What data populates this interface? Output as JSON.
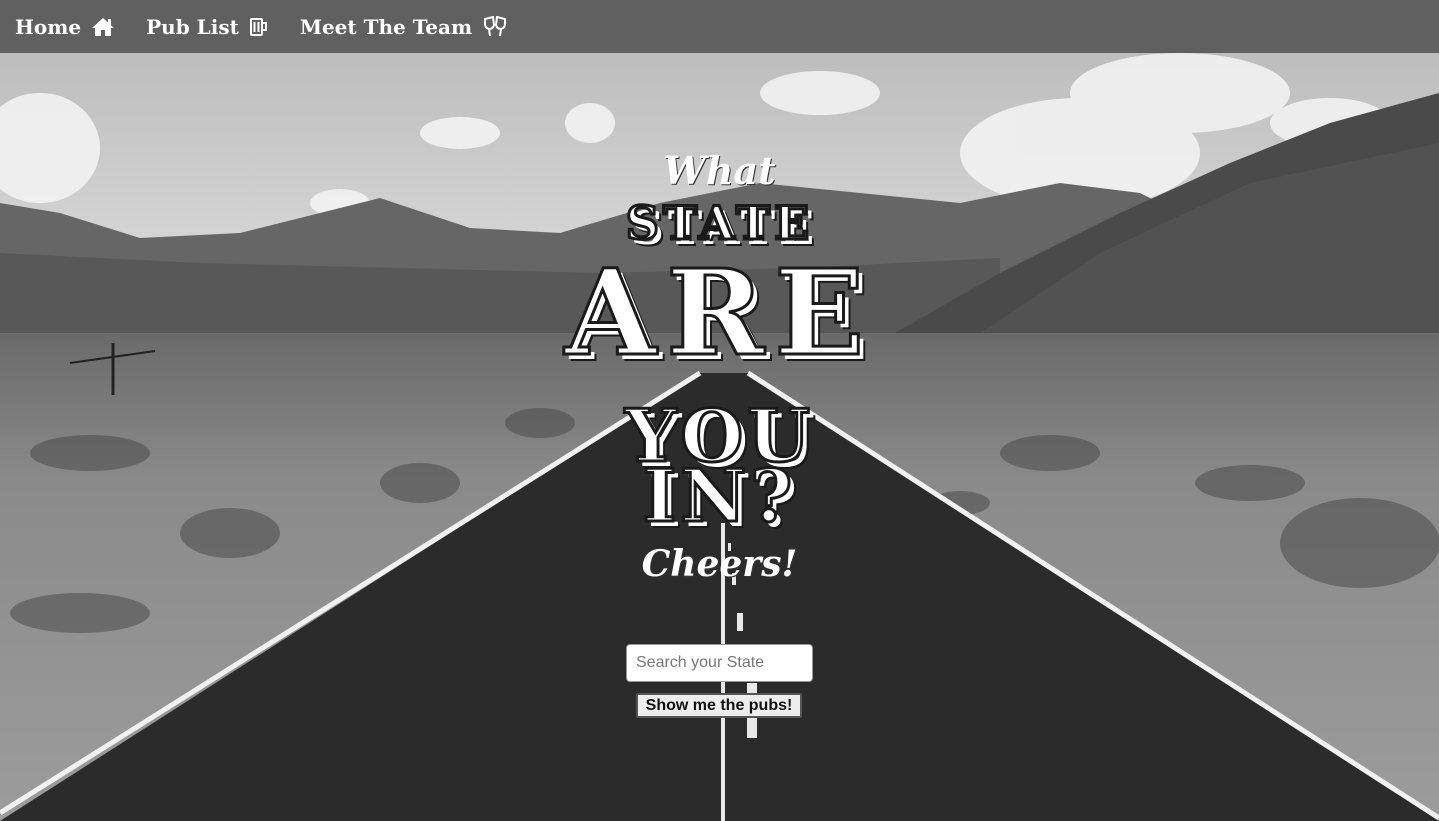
{
  "nav": {
    "items": [
      {
        "label": "Home",
        "icon": "home-icon"
      },
      {
        "label": "Pub List",
        "icon": "beer-mug-icon"
      },
      {
        "label": "Meet The Team",
        "icon": "cheers-glasses-icon"
      }
    ]
  },
  "hero": {
    "what": "What",
    "state": "STATE",
    "are": "ARE",
    "you": "YOU",
    "in": "IN?",
    "cheers": "Cheers!"
  },
  "search": {
    "placeholder": "Search your State",
    "value": "",
    "button_label": "Show me the pubs!"
  },
  "colors": {
    "navbar": "#606060",
    "text": "#ffffff"
  }
}
